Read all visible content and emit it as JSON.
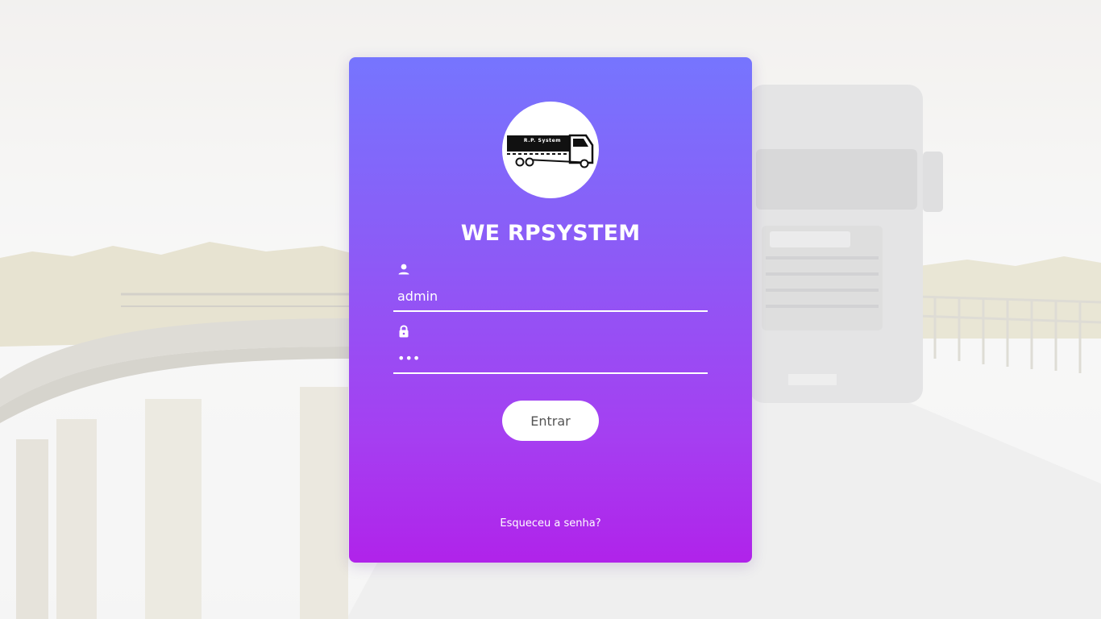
{
  "app": {
    "title": "WE RPSYSTEM",
    "logo_text": "R.P. System"
  },
  "form": {
    "username": {
      "icon": "user-icon",
      "value": "admin"
    },
    "password": {
      "icon": "lock-icon",
      "value": "***"
    },
    "submit_label": "Entrar",
    "forgot_label": "Esqueceu a senha?"
  },
  "colors": {
    "card_gradient_top": "#7675fe",
    "card_gradient_bottom": "#b023ea",
    "text": "#ffffff",
    "button_bg": "#ffffff",
    "button_text": "#555555"
  }
}
